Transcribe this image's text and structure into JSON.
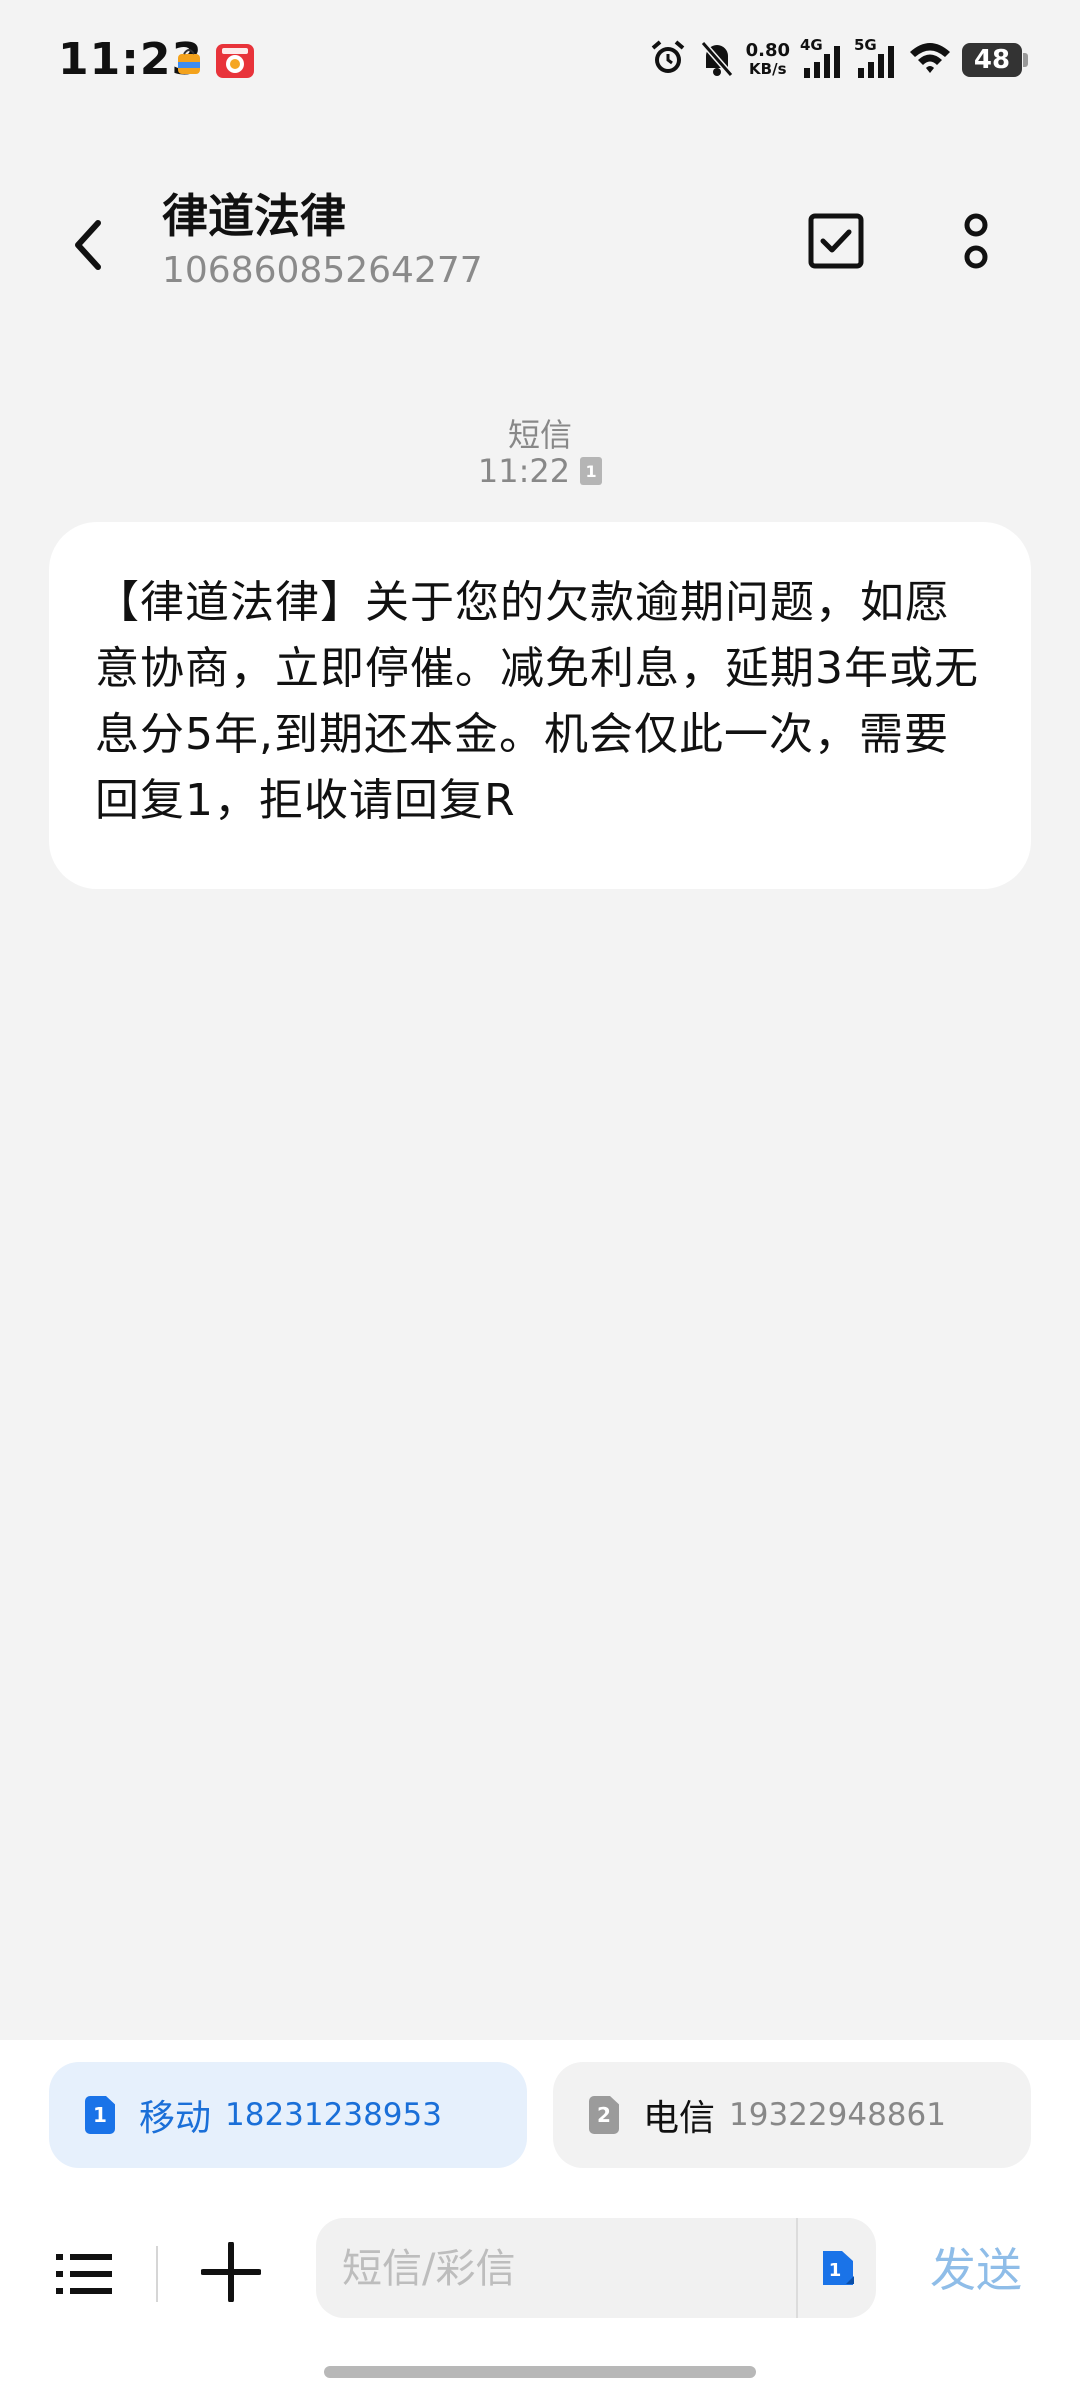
{
  "status_bar": {
    "time": "11:23",
    "net_speed_value": "0.80",
    "net_speed_unit": "KB/s",
    "sig1_label": "4G",
    "sig2_label": "5G",
    "battery": "48"
  },
  "header": {
    "contact_name": "律道法律",
    "contact_number": "10686085264277"
  },
  "message": {
    "type_label": "短信",
    "time": "11:22",
    "sim_slot": "1",
    "text": "【律道法律】关于您的欠款逾期问题，如愿意协商，立即停催。减免利息，延期3年或无息分5年,到期还本金。机会仅此一次，需要回复1，拒收请回复R"
  },
  "sim_options": [
    {
      "slot": "1",
      "carrier": "移动",
      "number": "18231238953",
      "selected": true
    },
    {
      "slot": "2",
      "carrier": "电信",
      "number": "19322948861",
      "selected": false
    }
  ],
  "composer": {
    "placeholder": "短信/彩信",
    "sim_slot": "1",
    "send_label": "发送"
  },
  "colors": {
    "accent": "#1a73e8",
    "send_disabled": "#8fbde8",
    "background": "#f3f3f3"
  }
}
